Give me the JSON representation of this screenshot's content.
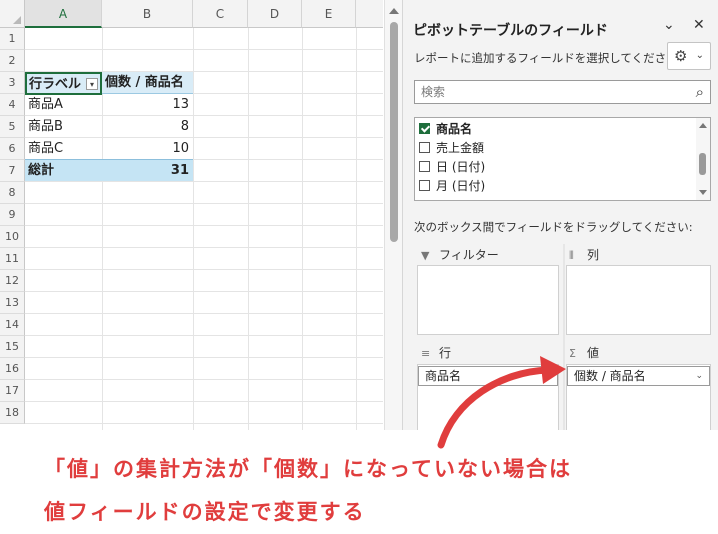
{
  "sheet": {
    "columns": [
      "A",
      "B",
      "C",
      "D",
      "E"
    ],
    "rows": [
      "1",
      "2",
      "3",
      "4",
      "5",
      "6",
      "7",
      "8",
      "9",
      "10",
      "11",
      "12",
      "13",
      "14",
      "15",
      "16",
      "17",
      "18"
    ],
    "pivot": {
      "row_label_header": "行ラベル",
      "value_header": "個数 / 商品名",
      "rows": [
        {
          "label": "商品A",
          "value": "13"
        },
        {
          "label": "商品B",
          "value": "8"
        },
        {
          "label": "商品C",
          "value": "10"
        }
      ],
      "total": {
        "label": "総計",
        "value": "31"
      }
    }
  },
  "pane": {
    "title": "ピボットテーブルのフィールド",
    "close": "✕",
    "collapse": "⌄",
    "subtitle": "レポートに追加するフィールドを選択してください:",
    "gear_icon": "⚙",
    "gear_chevron": "⌄",
    "search_placeholder": "検索",
    "search_icon": "⌕",
    "fields": [
      {
        "label": "商品名",
        "checked": true
      },
      {
        "label": "売上金額",
        "checked": false
      },
      {
        "label": "日 (日付)",
        "checked": false
      },
      {
        "label": "月 (日付)",
        "checked": false
      }
    ],
    "drag_hint": "次のボックス間でフィールドをドラッグしてください:",
    "areas": {
      "filter": {
        "label": "フィルター",
        "icon": "filter-icon"
      },
      "columns": {
        "label": "列",
        "icon": "columns-icon"
      },
      "rows": {
        "label": "行",
        "icon": "rows-icon",
        "pill": "商品名"
      },
      "values": {
        "label": "値",
        "icon": "sigma-icon",
        "pill": "個数 / 商品名",
        "pill_chevron": "⌄"
      }
    }
  },
  "annotation": {
    "line1": "「値」の集計方法が「個数」になっていない場合は",
    "line2": "値フィールドの設定で変更する",
    "color": "#e03d3d"
  }
}
